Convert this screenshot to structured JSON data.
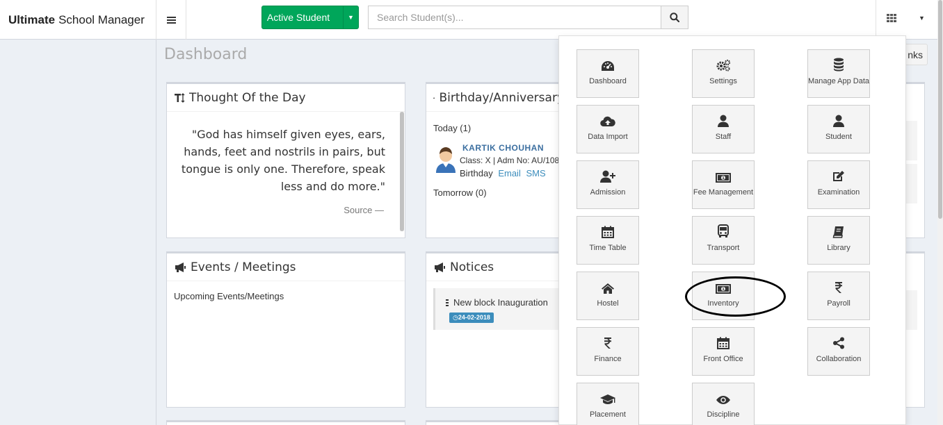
{
  "brand": {
    "bold": "Ultimate",
    "rest": "School Manager"
  },
  "header": {
    "active_student_label": "Active Student",
    "search_placeholder": "Search Student(s)..."
  },
  "page": {
    "title": "Dashboard",
    "links_label": "nks"
  },
  "thought": {
    "title": "Thought Of the Day",
    "text": "\"God has himself given eyes, ears, hands, feet and nostrils in pairs, but tongue is only one. Therefore, speak less and do more.\"",
    "source": "Source —"
  },
  "birthday": {
    "title": "Birthday/Anniversary",
    "today_label": "Today (1)",
    "person_name": "KARTIK CHOUHAN",
    "person_class": "Class: X | Adm No: AU/108",
    "type_label": "Birthday",
    "email_label": "Email",
    "sms_label": "SMS",
    "tomorrow_label": "Tomorrow (0)"
  },
  "events": {
    "title": "Events / Meetings",
    "subtitle": "Upcoming Events/Meetings"
  },
  "notices": {
    "title": "Notices",
    "item_title": "New block Inauguration",
    "item_date": "24-02-2018"
  },
  "apps": [
    {
      "label": "Dashboard",
      "icon": "dashboard-icon"
    },
    {
      "label": "Settings",
      "icon": "gears-icon"
    },
    {
      "label": "Manage App Data",
      "icon": "database-icon"
    },
    {
      "label": "Data Import",
      "icon": "cloud-upload-icon"
    },
    {
      "label": "Staff",
      "icon": "user-icon"
    },
    {
      "label": "Student",
      "icon": "user-icon"
    },
    {
      "label": "Admission",
      "icon": "user-plus-icon"
    },
    {
      "label": "Fee Management",
      "icon": "money-icon"
    },
    {
      "label": "Examination",
      "icon": "edit-icon"
    },
    {
      "label": "Time Table",
      "icon": "calendar-icon"
    },
    {
      "label": "Transport",
      "icon": "bus-icon"
    },
    {
      "label": "Library",
      "icon": "book-icon"
    },
    {
      "label": "Hostel",
      "icon": "home-icon"
    },
    {
      "label": "Inventory",
      "icon": "money-icon"
    },
    {
      "label": "Payroll",
      "icon": "rupee-icon"
    },
    {
      "label": "Finance",
      "icon": "rupee-icon"
    },
    {
      "label": "Front Office",
      "icon": "calendar-icon"
    },
    {
      "label": "Collaboration",
      "icon": "share-icon"
    },
    {
      "label": "Placement",
      "icon": "graduation-cap-icon"
    },
    {
      "label": "Discipline",
      "icon": "eye-icon"
    }
  ]
}
